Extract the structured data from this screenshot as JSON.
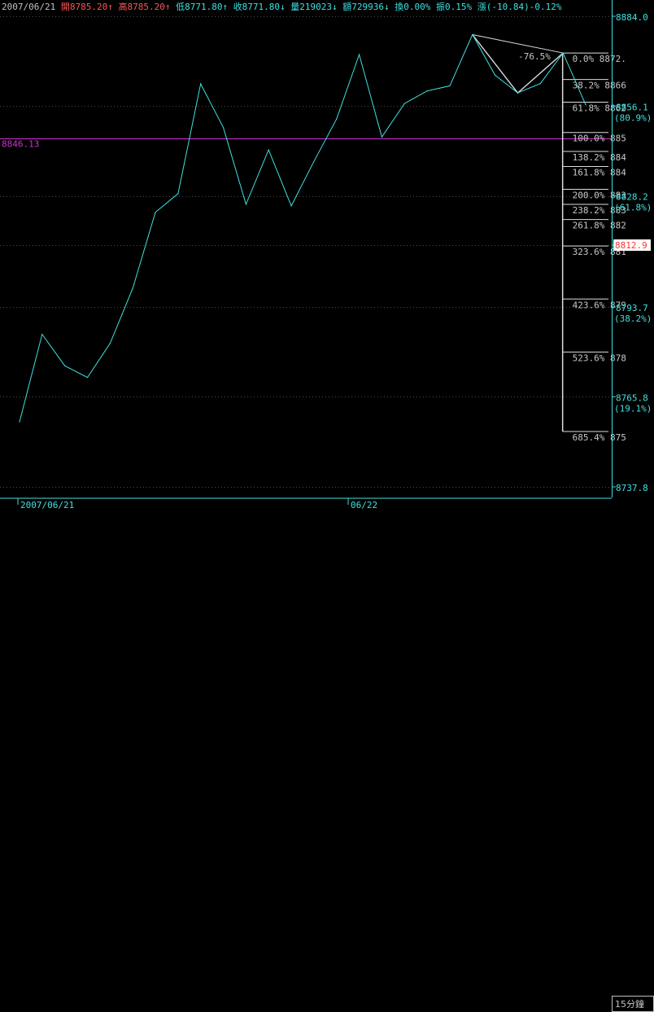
{
  "header": {
    "date": "2007/06/21",
    "items": [
      {
        "label": "開",
        "value": "8785.20",
        "arrow": "↑",
        "color": "#ff5555"
      },
      {
        "label": "高",
        "value": "8785.20",
        "arrow": "↑",
        "color": "#ff5555"
      },
      {
        "label": "低",
        "value": "8771.80",
        "arrow": "↑",
        "color": "#40e0e0"
      },
      {
        "label": "收",
        "value": "8771.80",
        "arrow": "↓",
        "color": "#40e0e0"
      },
      {
        "label": "量",
        "value": "219023",
        "arrow": "↓",
        "color": "#40e0e0"
      },
      {
        "label": "額",
        "value": "729936",
        "arrow": "↓",
        "color": "#40e0e0"
      },
      {
        "label": "換",
        "value": "0.00%",
        "arrow": "",
        "color": "#40e0e0"
      },
      {
        "label": "振",
        "value": "0.15%",
        "arrow": "",
        "color": "#40e0e0"
      },
      {
        "label": "漲",
        "value": "(-10.84)-0.12%",
        "arrow": "",
        "color": "#40e0e0"
      }
    ]
  },
  "colors": {
    "background": "#000000",
    "price_line": "#40e0e0",
    "reference_line": "#cc33cc",
    "fib_lines": "#ffffff",
    "axis": "#40e0e0",
    "last_price": "#ff3333",
    "grid": "#4a4a4a"
  },
  "bottom_bar": {
    "date_left": "2007/06/21",
    "date_mid": "06/22",
    "period_button": "15分鐘"
  },
  "chart_data": {
    "type": "line",
    "ylim": [
      8737.8,
      8884.0
    ],
    "y_ticks": [
      {
        "value": 8884.0,
        "label": "8884.0",
        "pct": ""
      },
      {
        "value": 8856.1,
        "label": "8856.1",
        "pct": "80.9%"
      },
      {
        "value": 8828.2,
        "label": "8828.2",
        "pct": "61.8%"
      },
      {
        "value": 8812.9,
        "label": "8810.9",
        "pct": ""
      },
      {
        "value": 8793.7,
        "label": "8793.7",
        "pct": "38.2%"
      },
      {
        "value": 8765.8,
        "label": "8765.8",
        "pct": "19.1%"
      },
      {
        "value": 8737.8,
        "label": "8737.8",
        "pct": ""
      }
    ],
    "x_labels": [
      "2007/06/21",
      "06/22"
    ],
    "series": [
      {
        "values": [
          8758.0,
          8785.2,
          8775.4,
          8771.8,
          8782.4,
          8799.5,
          8823.1,
          8828.9,
          8863.0,
          8849.4,
          8825.6,
          8842.5,
          8825.1,
          8838.9,
          8852.1,
          8872.1,
          8846.5,
          8856.9,
          8860.8,
          8862.4,
          8878.3,
          8865.7,
          8860.2,
          8863.1,
          8872.6,
          8856.5
        ]
      }
    ],
    "reference_line": {
      "value": 8846.13,
      "label": "8846.13"
    },
    "last_price": {
      "value": 8812.9,
      "label": "8812.9"
    },
    "fibonacci": {
      "annotation": "-76.5%",
      "levels": [
        {
          "pct": "0.0%",
          "price": "8872."
        },
        {
          "pct": "38.2%",
          "price": "8866"
        },
        {
          "pct": "61.8%",
          "price": "8862"
        },
        {
          "pct": "100.0%",
          "price": "885"
        },
        {
          "pct": "138.2%",
          "price": "884"
        },
        {
          "pct": "161.8%",
          "price": "884"
        },
        {
          "pct": "200.0%",
          "price": "883"
        },
        {
          "pct": "238.2%",
          "price": "883"
        },
        {
          "pct": "261.8%",
          "price": "882"
        },
        {
          "pct": "323.6%",
          "price": "881"
        },
        {
          "pct": "423.6%",
          "price": "879"
        },
        {
          "pct": "523.6%",
          "price": "878"
        },
        {
          "pct": "685.4%",
          "price": "875"
        }
      ]
    }
  }
}
